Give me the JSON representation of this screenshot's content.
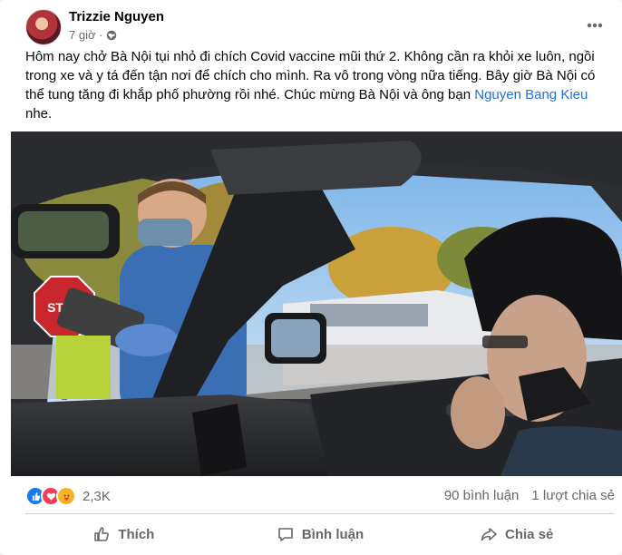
{
  "post": {
    "author": "Trizzie Nguyen",
    "time": "7 giờ ·",
    "text": "Hôm nay chở Bà Nội tụi nhỏ đi chích Covid vaccine mũi thứ 2.  Không cần ra khỏi xe luôn, ngồi trong xe và y tá đến tận nơi để chích cho mình.  Ra vô trong vòng nữa tiếng.  Bây giờ Bà Nội có thể tung tăng đi khắp phố phường rồi nhé.  Chúc mừng Bà Nội và ông bạn ",
    "mention": "Nguyen Bang Kieu",
    "text_end": " nhe."
  },
  "photo": {
    "sign_text": "STOP"
  },
  "stats": {
    "reaction_count": "2,3K",
    "comments": "90 bình luận",
    "shares": "1 lượt chia sẻ"
  },
  "actions": {
    "like": "Thích",
    "comment": "Bình luận",
    "share": "Chia sẻ"
  },
  "colors": {
    "accent": "#216fdb",
    "like_blue": "#1877f2",
    "love_red": "#f33e58",
    "care_yellow": "#f7b125"
  }
}
